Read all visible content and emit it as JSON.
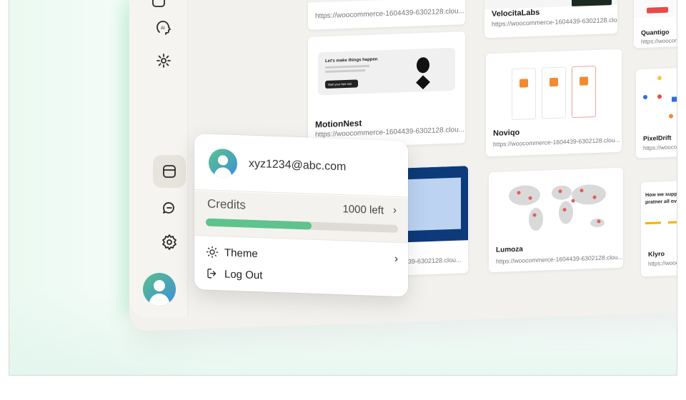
{
  "sites": [
    {
      "name": "",
      "url": "https://woocommerce-1604439-6302128.clou..."
    },
    {
      "name": "VelocitaLabs",
      "url": "https://woocommerce-1604439-6302128.clou..."
    },
    {
      "name": "Quantigo",
      "url": "https://woocommerc..."
    },
    {
      "name": "MotionNest",
      "url": "https://woocommerce-1604439-6302128.clou...",
      "thumb_heading": "Let's make things happen",
      "thumb_button": "Start your free trial"
    },
    {
      "name": "Noviqo",
      "url": "https://woocommerce-1604439-6302128.clou..."
    },
    {
      "name": "PixelDrift",
      "url": "https://woocomme..."
    },
    {
      "name": "",
      "url": "39-6302128.clou..."
    },
    {
      "name": "Lumoza",
      "url": "https://woocommerce-1604439-6302128.clou..."
    },
    {
      "name": "Klyro",
      "url": "https://woocom...",
      "thumb_heading": "How we support pratner all over th"
    }
  ],
  "sidebar": {
    "icons": [
      "ai-icon",
      "settings-spark-icon",
      "sites-icon",
      "chat-icon",
      "gear-icon"
    ],
    "active": "sites-icon"
  },
  "profile_menu": {
    "email": "xyz1234@abc.com",
    "credits_label": "Credits",
    "credits_left": "1000 left",
    "credits_fraction": 0.55,
    "theme_label": "Theme",
    "logout_label": "Log Out"
  },
  "colors": {
    "accent": "#5ec38c",
    "avatar_from": "#5cc38c",
    "avatar_to": "#3b8fd8"
  }
}
